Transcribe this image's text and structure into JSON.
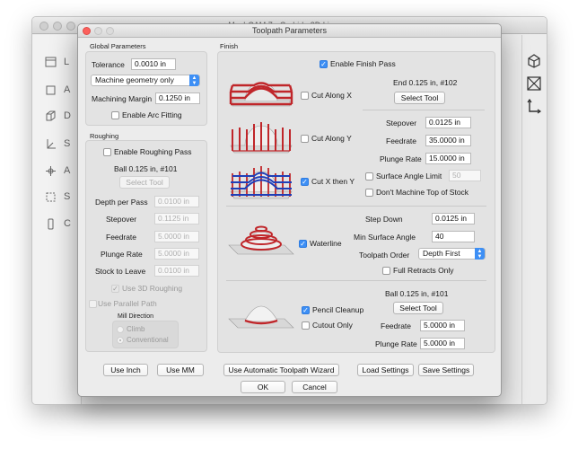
{
  "bg_window": {
    "title": "MeshCAM 7 - Carbide 3D License",
    "sidebar_labels": [
      "L",
      "A",
      "D",
      "S",
      "A",
      "S",
      "C"
    ]
  },
  "dialog": {
    "title": "Toolpath Parameters",
    "global": {
      "heading": "Global Parameters",
      "tolerance_label": "Tolerance",
      "tolerance_value": "0.0010 in",
      "geometry_select": "Machine geometry only",
      "margin_label": "Machining Margin",
      "margin_value": "0.1250 in",
      "arc_fitting_label": "Enable Arc Fitting"
    },
    "roughing": {
      "heading": "Roughing",
      "enable_label": "Enable Roughing Pass",
      "tool_name": "Ball 0.125 in, #101",
      "select_tool": "Select Tool",
      "depth_label": "Depth per Pass",
      "depth_value": "0.0100 in",
      "stepover_label": "Stepover",
      "stepover_value": "0.1125 in",
      "feedrate_label": "Feedrate",
      "feedrate_value": "5.0000 in",
      "plunge_label": "Plunge Rate",
      "plunge_value": "5.0000 in",
      "stock_label": "Stock to Leave",
      "stock_value": "0.0100 in",
      "use3d_label": "Use 3D Roughing",
      "parallel_label": "Use Parallel Path",
      "mill_direction_label": "Mill Direction",
      "climb_label": "Climb",
      "conventional_label": "Conventional"
    },
    "finish": {
      "heading": "Finish",
      "enable_label": "Enable Finish Pass",
      "cut_x_label": "Cut Along X",
      "cut_y_label": "Cut Along Y",
      "cut_xy_label": "Cut X then Y",
      "tool_name": "End 0.125 in, #102",
      "select_tool": "Select Tool",
      "stepover_label": "Stepover",
      "stepover_value": "0.0125 in",
      "feedrate_label": "Feedrate",
      "feedrate_value": "35.0000 in",
      "plunge_label": "Plunge Rate",
      "plunge_value": "15.0000 in",
      "surface_limit_label": "Surface Angle Limit",
      "surface_limit_value": "50",
      "dont_machine_top_label": "Don't Machine Top of Stock",
      "waterline_label": "Waterline",
      "step_down_label": "Step Down",
      "step_down_value": "0.0125 in",
      "min_surface_label": "Min Surface Angle",
      "min_surface_value": "40",
      "toolpath_order_label": "Toolpath Order",
      "toolpath_order_value": "Depth First",
      "full_retracts_label": "Full Retracts Only",
      "pencil_label": "Pencil Cleanup",
      "cutout_label": "Cutout Only",
      "pencil_tool_name": "Ball 0.125 in, #101",
      "pencil_select_tool": "Select Tool",
      "pencil_feedrate_label": "Feedrate",
      "pencil_feedrate_value": "5.0000 in",
      "pencil_plunge_label": "Plunge Rate",
      "pencil_plunge_value": "5.0000 in"
    },
    "footer": {
      "use_inch": "Use Inch",
      "use_mm": "Use MM",
      "wizard": "Use Automatic Toolpath Wizard",
      "load": "Load Settings",
      "save": "Save Settings",
      "ok": "OK",
      "cancel": "Cancel"
    },
    "check_glyph": "✓",
    "colors": {
      "accent": "#3d8ff5",
      "path_red": "#c0262a",
      "path_blue": "#1f3fb8",
      "close": "#fc605c",
      "min": "#fdbc40",
      "max": "#34c84a"
    }
  }
}
